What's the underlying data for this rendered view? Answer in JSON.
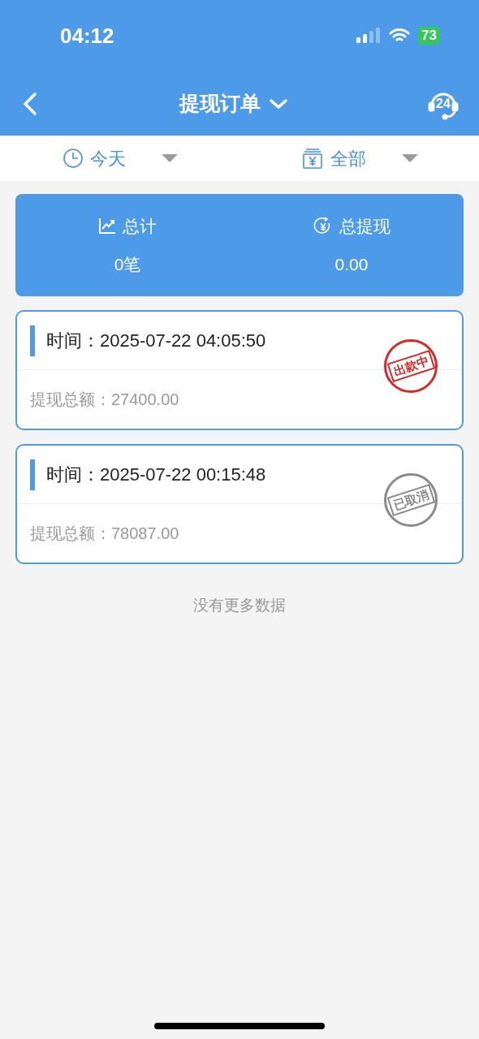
{
  "status_bar": {
    "time": "04:12",
    "battery": "73"
  },
  "header": {
    "title": "提现订单",
    "badge": "24"
  },
  "filters": [
    {
      "kind": "date",
      "label": "今天"
    },
    {
      "kind": "type",
      "label": "全部"
    }
  ],
  "summary": [
    {
      "kind": "count",
      "label": "总计",
      "value": "0笔"
    },
    {
      "kind": "amount",
      "label": "总提现",
      "value": "0.00"
    }
  ],
  "orders": [
    {
      "time_label": "时间：",
      "time": "2025-07-22 04:05:50",
      "amount_label": "提现总额：",
      "amount": "27400.00",
      "stamp": {
        "text": "出款中",
        "color": "#d42a2a"
      }
    },
    {
      "time_label": "时间：",
      "time": "2025-07-22 00:15:48",
      "amount_label": "提现总额：",
      "amount": "78087.00",
      "stamp": {
        "text": "已取消",
        "color": "#8a8a8a"
      }
    }
  ],
  "footer": "没有更多数据"
}
